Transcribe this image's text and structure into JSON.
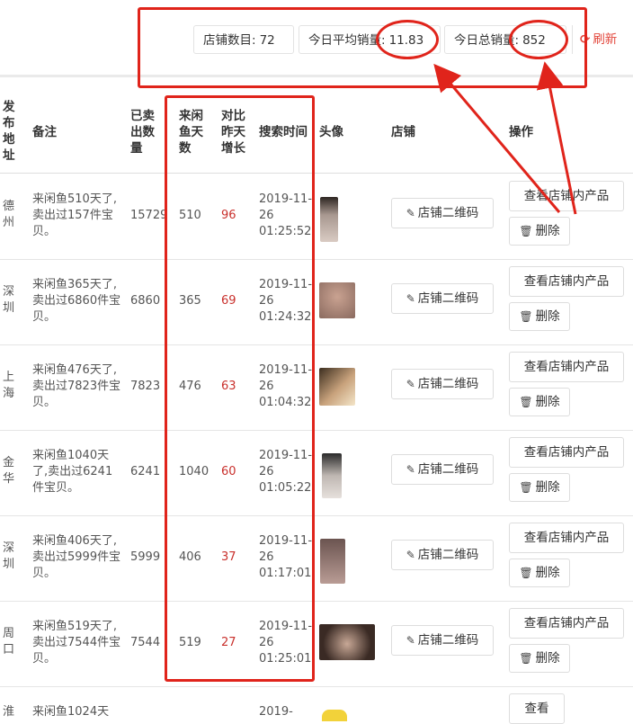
{
  "stats": {
    "shop_count_label": "店铺数目:",
    "shop_count_value": "72",
    "avg_sales_label": "今日平均销量:",
    "avg_sales_value": "11.83",
    "total_sales_label": "今日总销量:",
    "total_sales_value": "852",
    "refresh_label": "刷新"
  },
  "table": {
    "headers": {
      "address": "发布地址",
      "note": "备注",
      "sold": "已卖出数量",
      "days": "来闲鱼天数",
      "increase": "对比昨天增长",
      "search_time": "搜索时间",
      "avatar": "头像",
      "shop": "店铺",
      "action": "操作"
    },
    "rows": [
      {
        "address": "德州",
        "note": "来闲鱼510天了,卖出过157件宝贝。",
        "sold": "15729",
        "days": "510",
        "increase": "96",
        "time": "2019-11-26 01:25:52"
      },
      {
        "address": "深圳",
        "note": "来闲鱼365天了,卖出过6860件宝贝。",
        "sold": "6860",
        "days": "365",
        "increase": "69",
        "time": "2019-11-26 01:24:32"
      },
      {
        "address": "上海",
        "note": "来闲鱼476天了,卖出过7823件宝贝。",
        "sold": "7823",
        "days": "476",
        "increase": "63",
        "time": "2019-11-26 01:04:32"
      },
      {
        "address": "金华",
        "note": "来闲鱼1040天了,卖出过6241件宝贝。",
        "sold": "6241",
        "days": "1040",
        "increase": "60",
        "time": "2019-11-26 01:05:22"
      },
      {
        "address": "深圳",
        "note": "来闲鱼406天了,卖出过5999件宝贝。",
        "sold": "5999",
        "days": "406",
        "increase": "37",
        "time": "2019-11-26 01:17:01"
      },
      {
        "address": "周口",
        "note": "来闲鱼519天了,卖出过7544件宝贝。",
        "sold": "7544",
        "days": "519",
        "increase": "27",
        "time": "2019-11-26 01:25:01"
      }
    ],
    "partial_row": {
      "address": "淮",
      "note": "来闲鱼1024天",
      "time": "2019-",
      "view_label": "查看"
    },
    "qr_label": "店铺二维码",
    "view_label": "查看店铺内产品",
    "delete_label": "删除"
  },
  "colors": {
    "annotation_red": "#e0241b",
    "increase_red": "#c9302c",
    "refresh_red": "#e2463b"
  }
}
